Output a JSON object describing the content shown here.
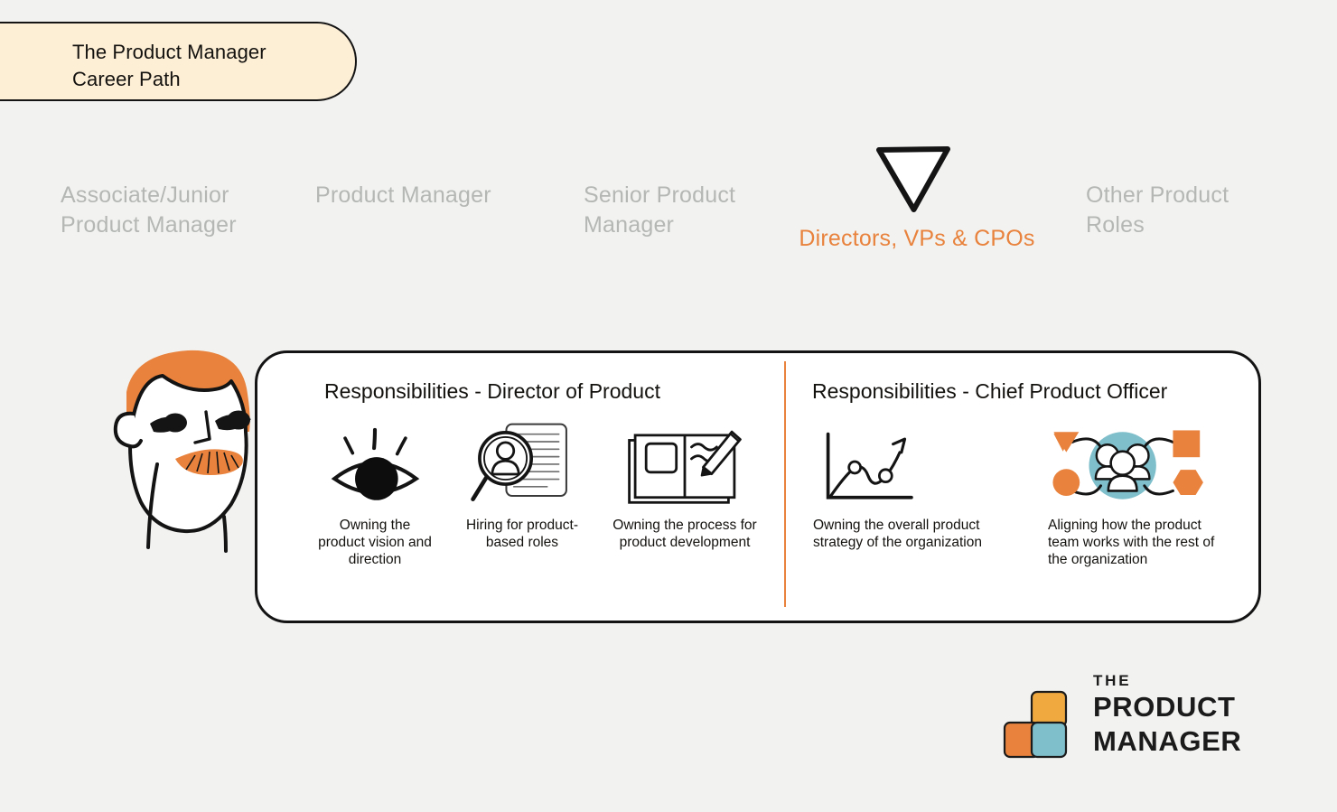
{
  "page": {
    "background_color": "#f2f3f1",
    "accent_orange": "#e8823c",
    "accent_teal": "#7fbfcb",
    "accent_yellow": "#efa93f",
    "title_pill_color": "#fdeed6",
    "ink_color": "#141414",
    "muted_color": "#b4b7b4"
  },
  "title": {
    "line1": "The Product Manager",
    "line2": "Career Path"
  },
  "stages": [
    {
      "label": "Associate/Junior Product Manager",
      "active": false
    },
    {
      "label": "Product Manager",
      "active": false
    },
    {
      "label": "Senior Product Manager",
      "active": false
    },
    {
      "label": "Directors, VPs & CPOs",
      "active": true
    },
    {
      "label": "Other Product Roles",
      "active": false
    }
  ],
  "marker": {
    "icon": "triangle-down-marker-icon"
  },
  "panels": [
    {
      "heading": "Responsibilities - Director of Product",
      "items": [
        {
          "icon": "eye-icon",
          "caption": "Owning the product vision and direction"
        },
        {
          "icon": "magnifier-resume-icon",
          "caption": "Hiring for product-based roles"
        },
        {
          "icon": "notebook-pencil-icon",
          "caption": "Owning the process for product development"
        }
      ]
    },
    {
      "heading": "Responsibilities - Chief Product Officer",
      "items": [
        {
          "icon": "growth-chart-icon",
          "caption": "Owning the overall product strategy of the organization"
        },
        {
          "icon": "team-network-icon",
          "caption": "Aligning how the product team works with the rest of the organization"
        }
      ]
    }
  ],
  "character": {
    "icon": "person-illustration"
  },
  "logo": {
    "line1": "THE",
    "line2": "PRODUCT",
    "line3": "MANAGER",
    "mark": "three-squares-logo-mark"
  }
}
